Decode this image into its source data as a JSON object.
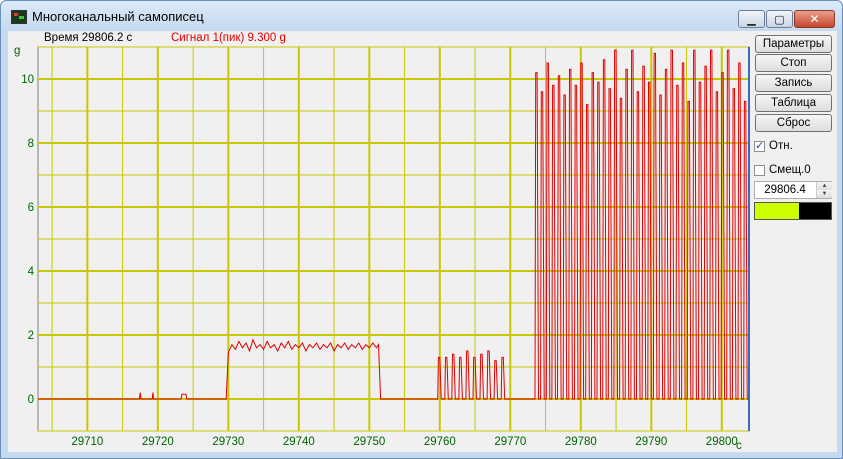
{
  "window": {
    "title": "Многоканальный самописец"
  },
  "header": {
    "time_label": "Время 29806.2 с",
    "signal_label": "Сигнал 1(пик) 9.300 g"
  },
  "buttons": {
    "params": "Параметры",
    "stop": "Стоп",
    "record": "Запись",
    "table": "Таблица",
    "reset": "Сброс"
  },
  "checks": {
    "rel": {
      "label": "Отн.",
      "checked": true
    },
    "offset": {
      "label": "Смещ.0",
      "checked": false
    }
  },
  "spin": {
    "value": "29806.4"
  },
  "colors": {
    "grid": "#c8c800",
    "signal": "#e00000",
    "swatch_a": "#ccff00",
    "swatch_b": "#000000",
    "tick_labels": "#006400"
  },
  "chart_data": {
    "type": "line",
    "ylabel": "g",
    "xlabel": "с",
    "xlim": [
      29703,
      29804
    ],
    "ylim": [
      -1,
      11
    ],
    "x_ticks": [
      29710,
      29720,
      29730,
      29740,
      29750,
      29760,
      29770,
      29780,
      29790,
      29800
    ],
    "y_ticks": [
      0,
      2,
      4,
      6,
      8,
      10
    ],
    "grid": true,
    "series": [
      {
        "points": [
          [
            29703,
            0
          ],
          [
            29717.4,
            0
          ],
          [
            29717.5,
            0.2
          ],
          [
            29717.6,
            0
          ],
          [
            29719.2,
            0
          ],
          [
            29719.3,
            0.2
          ],
          [
            29719.4,
            0
          ],
          [
            29723.3,
            0
          ],
          [
            29723.4,
            0.15
          ],
          [
            29724,
            0.15
          ],
          [
            29724.1,
            0
          ],
          [
            29729.7,
            0
          ],
          [
            29730,
            1.45
          ],
          [
            29730.5,
            1.7
          ],
          [
            29731,
            1.55
          ],
          [
            29731.5,
            1.8
          ],
          [
            29732,
            1.6
          ],
          [
            29732.5,
            1.75
          ],
          [
            29733,
            1.5
          ],
          [
            29733.5,
            1.85
          ],
          [
            29734,
            1.6
          ],
          [
            29734.5,
            1.7
          ],
          [
            29735,
            1.55
          ],
          [
            29735.5,
            1.8
          ],
          [
            29736,
            1.6
          ],
          [
            29736.5,
            1.7
          ],
          [
            29737,
            1.5
          ],
          [
            29737.5,
            1.75
          ],
          [
            29738,
            1.6
          ],
          [
            29738.5,
            1.8
          ],
          [
            29739,
            1.55
          ],
          [
            29739.5,
            1.7
          ],
          [
            29740,
            1.6
          ],
          [
            29740.5,
            1.75
          ],
          [
            29741,
            1.5
          ],
          [
            29741.5,
            1.7
          ],
          [
            29742,
            1.6
          ],
          [
            29742.5,
            1.75
          ],
          [
            29743,
            1.55
          ],
          [
            29743.5,
            1.7
          ],
          [
            29744,
            1.6
          ],
          [
            29744.5,
            1.75
          ],
          [
            29745,
            1.5
          ],
          [
            29745.5,
            1.7
          ],
          [
            29746,
            1.6
          ],
          [
            29746.5,
            1.75
          ],
          [
            29747,
            1.55
          ],
          [
            29747.5,
            1.7
          ],
          [
            29748,
            1.6
          ],
          [
            29748.5,
            1.75
          ],
          [
            29749,
            1.55
          ],
          [
            29749.5,
            1.7
          ],
          [
            29750,
            1.6
          ],
          [
            29750.5,
            1.75
          ],
          [
            29751,
            1.6
          ],
          [
            29751.3,
            1.7
          ],
          [
            29751.6,
            0
          ],
          [
            29759.7,
            0
          ],
          [
            29759.8,
            1.3
          ],
          [
            29760,
            1.3
          ],
          [
            29760.2,
            0
          ],
          [
            29760.7,
            0
          ],
          [
            29760.8,
            1.3
          ],
          [
            29761,
            1.3
          ],
          [
            29761.2,
            0
          ],
          [
            29761.7,
            0
          ],
          [
            29761.8,
            1.4
          ],
          [
            29762,
            1.4
          ],
          [
            29762.2,
            0
          ],
          [
            29762.7,
            0
          ],
          [
            29762.8,
            1.3
          ],
          [
            29763,
            1.3
          ],
          [
            29763.2,
            0
          ],
          [
            29763.7,
            0
          ],
          [
            29763.8,
            1.5
          ],
          [
            29764,
            1.5
          ],
          [
            29764.2,
            0
          ],
          [
            29764.7,
            0
          ],
          [
            29764.8,
            1.3
          ],
          [
            29765,
            1.3
          ],
          [
            29765.2,
            0
          ],
          [
            29765.7,
            0
          ],
          [
            29765.8,
            1.4
          ],
          [
            29766,
            1.4
          ],
          [
            29766.2,
            0
          ],
          [
            29766.7,
            0
          ],
          [
            29766.8,
            1.5
          ],
          [
            29767,
            1.5
          ],
          [
            29767.2,
            0
          ],
          [
            29767.7,
            0
          ],
          [
            29767.8,
            1.2
          ],
          [
            29768,
            1.2
          ],
          [
            29768.2,
            0
          ],
          [
            29768.7,
            0
          ],
          [
            29768.8,
            1.3
          ],
          [
            29769,
            1.3
          ],
          [
            29769.2,
            0
          ],
          [
            29773.5,
            0
          ],
          [
            29773.6,
            10.2
          ],
          [
            29773.8,
            10.2
          ],
          [
            29774,
            0
          ],
          [
            29774.3,
            0
          ],
          [
            29774.4,
            9.6
          ],
          [
            29774.6,
            9.6
          ],
          [
            29774.8,
            0
          ],
          [
            29775.1,
            0
          ],
          [
            29775.2,
            10.5
          ],
          [
            29775.4,
            10.5
          ],
          [
            29775.6,
            0
          ],
          [
            29775.9,
            0
          ],
          [
            29776,
            9.8
          ],
          [
            29776.2,
            9.8
          ],
          [
            29776.4,
            0
          ],
          [
            29776.7,
            0
          ],
          [
            29776.8,
            10.1
          ],
          [
            29777,
            10.1
          ],
          [
            29777.2,
            0
          ],
          [
            29777.5,
            0
          ],
          [
            29777.6,
            9.5
          ],
          [
            29777.8,
            9.5
          ],
          [
            29778,
            0
          ],
          [
            29778.3,
            0
          ],
          [
            29778.4,
            10.3
          ],
          [
            29778.6,
            10.3
          ],
          [
            29778.8,
            0
          ],
          [
            29779.1,
            0
          ],
          [
            29779.2,
            9.8
          ],
          [
            29779.4,
            9.8
          ],
          [
            29779.6,
            0
          ],
          [
            29779.9,
            0
          ],
          [
            29780,
            10.5
          ],
          [
            29780.2,
            10.5
          ],
          [
            29780.4,
            0
          ],
          [
            29780.7,
            0
          ],
          [
            29780.8,
            9.2
          ],
          [
            29781,
            9.2
          ],
          [
            29781.2,
            0
          ],
          [
            29781.5,
            0
          ],
          [
            29781.6,
            10.2
          ],
          [
            29781.8,
            10.2
          ],
          [
            29782,
            0
          ],
          [
            29782.3,
            0
          ],
          [
            29782.4,
            9.9
          ],
          [
            29782.6,
            9.9
          ],
          [
            29782.8,
            0
          ],
          [
            29783.1,
            0
          ],
          [
            29783.2,
            10.6
          ],
          [
            29783.4,
            10.6
          ],
          [
            29783.6,
            0
          ],
          [
            29783.9,
            0
          ],
          [
            29784,
            9.7
          ],
          [
            29784.2,
            9.7
          ],
          [
            29784.4,
            0
          ],
          [
            29784.7,
            0
          ],
          [
            29784.8,
            10.9
          ],
          [
            29785,
            10.9
          ],
          [
            29785.2,
            0
          ],
          [
            29785.5,
            0
          ],
          [
            29785.6,
            9.4
          ],
          [
            29785.8,
            9.4
          ],
          [
            29786,
            0
          ],
          [
            29786.3,
            0
          ],
          [
            29786.4,
            10.3
          ],
          [
            29786.6,
            10.3
          ],
          [
            29786.8,
            0
          ],
          [
            29787.1,
            0
          ],
          [
            29787.2,
            10.9
          ],
          [
            29787.4,
            10.9
          ],
          [
            29787.6,
            0
          ],
          [
            29787.9,
            0
          ],
          [
            29788,
            9.6
          ],
          [
            29788.2,
            9.6
          ],
          [
            29788.4,
            0
          ],
          [
            29788.7,
            0
          ],
          [
            29788.8,
            10.4
          ],
          [
            29789,
            10.4
          ],
          [
            29789.2,
            0
          ],
          [
            29789.5,
            0
          ],
          [
            29789.6,
            9.9
          ],
          [
            29789.8,
            9.9
          ],
          [
            29790,
            0
          ],
          [
            29790.3,
            0
          ],
          [
            29790.4,
            10.8
          ],
          [
            29790.6,
            10.8
          ],
          [
            29790.8,
            0
          ],
          [
            29791.1,
            0
          ],
          [
            29791.2,
            9.5
          ],
          [
            29791.4,
            9.5
          ],
          [
            29791.6,
            0
          ],
          [
            29791.9,
            0
          ],
          [
            29792,
            10.3
          ],
          [
            29792.2,
            10.3
          ],
          [
            29792.4,
            0
          ],
          [
            29792.7,
            0
          ],
          [
            29792.8,
            10.9
          ],
          [
            29793,
            10.9
          ],
          [
            29793.2,
            0
          ],
          [
            29793.5,
            0
          ],
          [
            29793.6,
            9.8
          ],
          [
            29793.8,
            9.8
          ],
          [
            29794,
            0
          ],
          [
            29794.3,
            0
          ],
          [
            29794.4,
            10.5
          ],
          [
            29794.6,
            10.5
          ],
          [
            29794.8,
            0
          ],
          [
            29795.1,
            0
          ],
          [
            29795.2,
            9.3
          ],
          [
            29795.4,
            9.3
          ],
          [
            29795.6,
            0
          ],
          [
            29795.9,
            0
          ],
          [
            29796,
            10.9
          ],
          [
            29796.2,
            10.9
          ],
          [
            29796.4,
            0
          ],
          [
            29796.7,
            0
          ],
          [
            29796.8,
            9.9
          ],
          [
            29797,
            9.9
          ],
          [
            29797.2,
            0
          ],
          [
            29797.5,
            0
          ],
          [
            29797.6,
            10.4
          ],
          [
            29797.8,
            10.4
          ],
          [
            29798,
            0
          ],
          [
            29798.3,
            0
          ],
          [
            29798.4,
            10.9
          ],
          [
            29798.6,
            10.9
          ],
          [
            29798.8,
            0
          ],
          [
            29799.1,
            0
          ],
          [
            29799.2,
            9.6
          ],
          [
            29799.4,
            9.6
          ],
          [
            29799.6,
            0
          ],
          [
            29799.9,
            0
          ],
          [
            29800,
            10.2
          ],
          [
            29800.2,
            10.2
          ],
          [
            29800.4,
            0
          ],
          [
            29800.7,
            0
          ],
          [
            29800.8,
            10.9
          ],
          [
            29801,
            10.9
          ],
          [
            29801.2,
            0
          ],
          [
            29801.5,
            0
          ],
          [
            29801.6,
            9.7
          ],
          [
            29801.8,
            9.7
          ],
          [
            29802,
            0
          ],
          [
            29802.3,
            0
          ],
          [
            29802.4,
            10.5
          ],
          [
            29802.6,
            10.5
          ],
          [
            29802.8,
            0
          ],
          [
            29803.1,
            0
          ],
          [
            29803.2,
            9.3
          ],
          [
            29803.4,
            9.3
          ],
          [
            29803.6,
            0
          ],
          [
            29804,
            0
          ]
        ]
      }
    ]
  }
}
